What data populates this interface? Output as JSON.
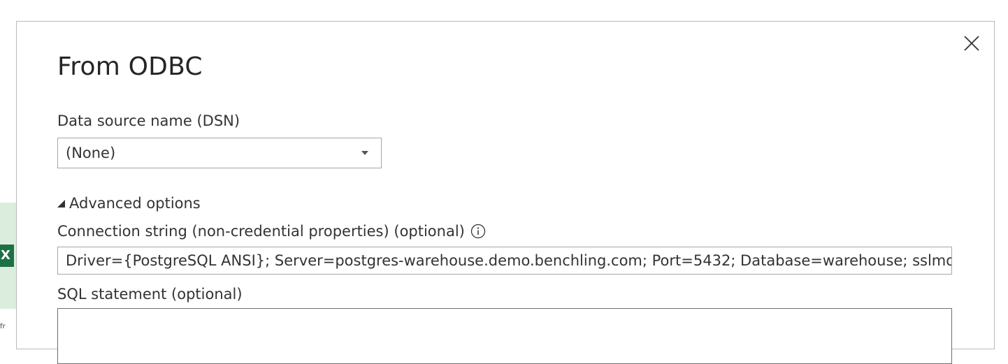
{
  "background_app": {
    "icon_letter": "X",
    "peek_text": "fr"
  },
  "dialog": {
    "title": "From ODBC",
    "close_icon": "close-icon",
    "dsn": {
      "label": "Data source name (DSN)",
      "selected": "(None)"
    },
    "advanced": {
      "label": "Advanced options",
      "expanded": true
    },
    "connection_string": {
      "label": "Connection string (non-credential properties) (optional)",
      "value": "Driver={PostgreSQL ANSI}; Server=postgres-warehouse.demo.benchling.com; Port=5432; Database=warehouse; sslmod"
    },
    "sql_statement": {
      "label": "SQL statement (optional)",
      "value": ""
    }
  }
}
